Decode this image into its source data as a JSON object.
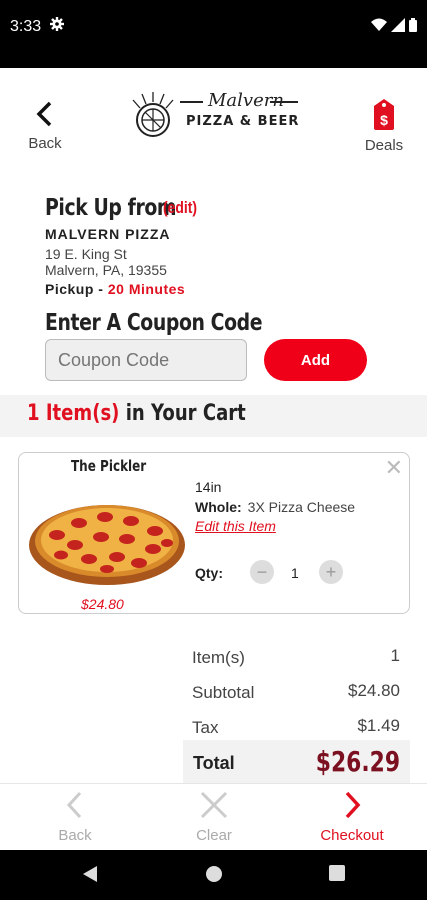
{
  "status_bar": {
    "time": "3:33",
    "gear_icon": "gear-icon",
    "wifi_icon": "wifi-icon",
    "signal_icon": "signal-icon",
    "battery_icon": "battery-icon"
  },
  "header": {
    "back_label": "Back",
    "deals_label": "Deals",
    "logo": {
      "script": "Malvern",
      "main": "PIZZA & BEER"
    }
  },
  "pickup": {
    "title": "Pick Up from",
    "edit_label": "(edit)",
    "store_name": "MALVERN PIZZA",
    "address_line1": "19 E. King St",
    "address_line2": "Malvern, PA, 19355",
    "pickup_label": "Pickup - ",
    "pickup_time": "20 Minutes"
  },
  "coupon": {
    "title": "Enter A Coupon Code",
    "placeholder": "Coupon Code",
    "add_label": "Add"
  },
  "cart": {
    "count_text": "1 Item(s)",
    "suffix_text": " in Your Cart"
  },
  "item": {
    "name": "The Pickler",
    "price": "$24.80",
    "size": "14in",
    "whole_label": "Whole:",
    "whole_value": "3X Pizza Cheese",
    "edit_label": "Edit this Item",
    "qty_label": "Qty:",
    "qty_value": "1",
    "close_symbol": "✕",
    "minus_symbol": "−",
    "plus_symbol": "+"
  },
  "summary": {
    "items_label": "Item(s)",
    "items_value": "1",
    "subtotal_label": "Subtotal",
    "subtotal_value": "$24.80",
    "tax_label": "Tax",
    "tax_value": "$1.49",
    "total_label": "Total",
    "total_value": "$26.29"
  },
  "bottom_nav": {
    "back_label": "Back",
    "clear_label": "Clear",
    "checkout_label": "Checkout"
  },
  "colors": {
    "accent": "#e01020",
    "total": "#7a1020",
    "add_button": "#f00018"
  }
}
